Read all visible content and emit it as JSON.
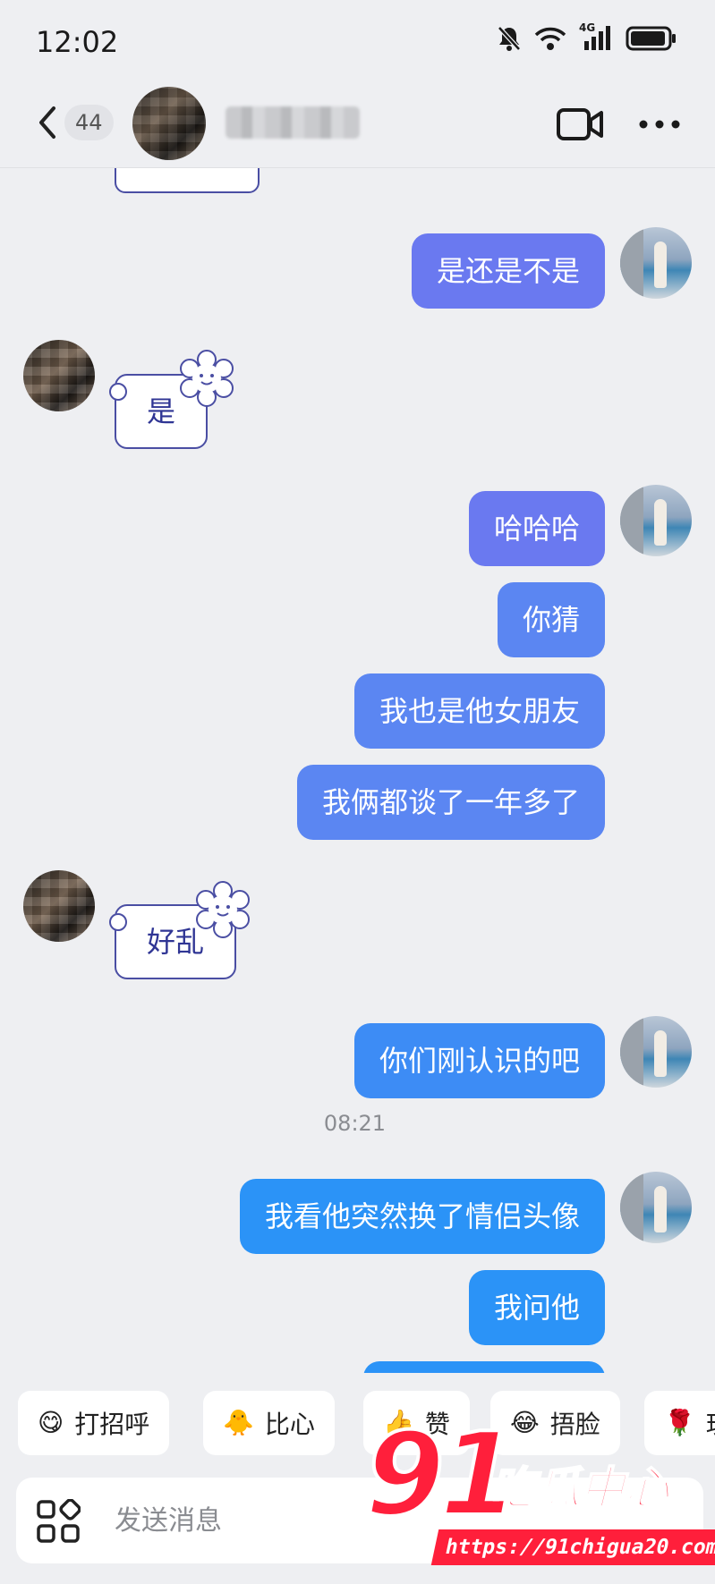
{
  "status_bar": {
    "time": "12:02",
    "network": "4G",
    "icons": [
      "mute-icon",
      "wifi-icon",
      "signal-icon",
      "battery-icon"
    ]
  },
  "header": {
    "unread_count": "44",
    "icons": [
      "back-arrow-icon",
      "video-call-icon",
      "more-icon"
    ]
  },
  "messages": [
    {
      "side": "out",
      "text": "是还是不是"
    },
    {
      "side": "in",
      "text": "是"
    },
    {
      "side": "out",
      "text": "哈哈哈"
    },
    {
      "side": "out",
      "text": "你猜"
    },
    {
      "side": "out",
      "text": "我也是他女朋友"
    },
    {
      "side": "out",
      "text": "我俩都谈了一年多了"
    },
    {
      "side": "in",
      "text": "好乱"
    },
    {
      "side": "out",
      "text": "你们刚认识的吧"
    },
    {
      "side": "time",
      "text": "08:21"
    },
    {
      "side": "out",
      "text": "我看他突然换了情侣头像"
    },
    {
      "side": "out",
      "text": "我问他"
    }
  ],
  "quick_replies": [
    {
      "emoji": "😋",
      "label": "打招呼"
    },
    {
      "emoji": "🐥",
      "label": "比心"
    },
    {
      "emoji": "👍",
      "label": "赞"
    },
    {
      "emoji": "😂",
      "label": "捂脸"
    },
    {
      "emoji": "🌹",
      "label": "玫"
    }
  ],
  "input": {
    "placeholder": "发送消息"
  },
  "watermark": {
    "logo_number": "91",
    "logo_text": "吃瓜中心",
    "url": "https://91chigua20.com"
  },
  "colors": {
    "background": "#eeeff2",
    "bubble_purple": "#6a79f0",
    "bubble_blue": "#2b93f7",
    "incoming_border": "#4a4ea3",
    "incoming_text": "#2f3594",
    "watermark_red": "#ff1f3b"
  }
}
